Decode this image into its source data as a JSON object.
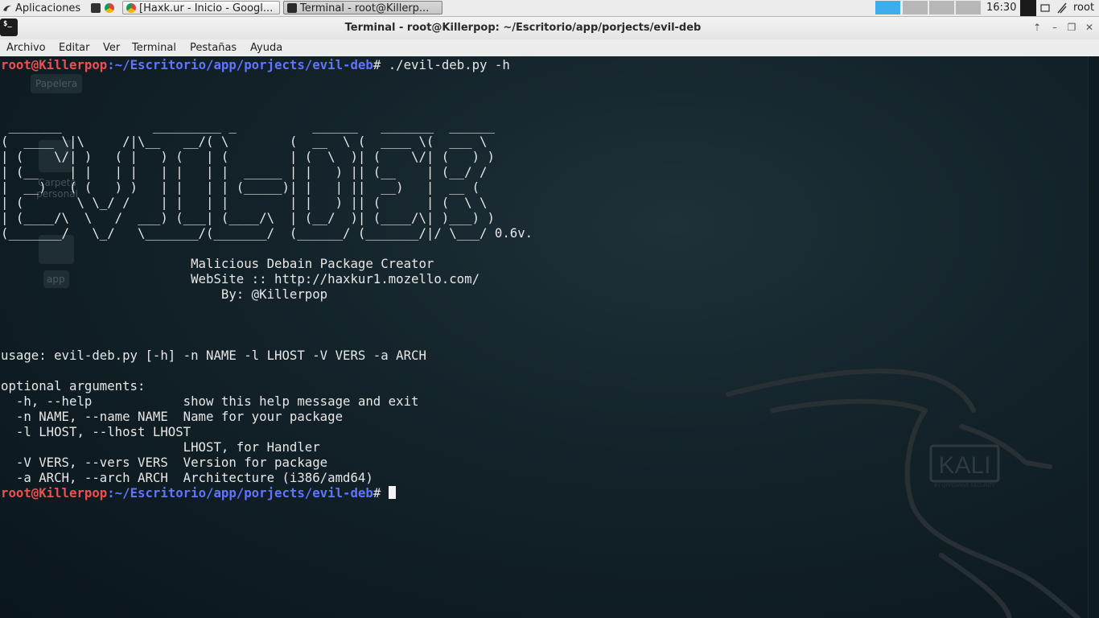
{
  "panel": {
    "apps_label": "Aplicaciones",
    "tasks": [
      {
        "label": "[Haxk.ur - Inicio - Googl..."
      },
      {
        "label": "Terminal - root@Killerp..."
      }
    ],
    "clock": "16:30",
    "user": "root"
  },
  "window": {
    "title": "Terminal - root@Killerpop: ~/Escritorio/app/porjects/evil-deb",
    "menu": [
      "Archivo",
      "Editar",
      "Ver",
      "Terminal",
      "Pestañas",
      "Ayuda"
    ]
  },
  "desktop": {
    "icons": [
      "Papelera",
      "Carpeta personal",
      "app"
    ]
  },
  "terminal": {
    "prompt_user": "root@Killerpop",
    "prompt_path": ":~/Escritorio/app/porjects/evil-deb",
    "prompt_symbol": "# ",
    "command": "./evil-deb.py -h",
    "banner": [
      " _______            _________ _          ______   _______  ______  ",
      "(  ____ \\|\\     /|\\__   __/( \\        (  __  \\ (  ____ \\(  ___ \\ ",
      "| (    \\/| )   ( |   ) (   | (        | (  \\  )| (    \\/| (   ) )",
      "| (__    | |   | |   | |   | |  _____ | |   ) || (__    | (__/ / ",
      "|  __)   ( (   ) )   | |   | | (_____)| |   | ||  __)   |  __ (  ",
      "| (       \\ \\_/ /    | |   | |        | |   ) || (      | (  \\ \\ ",
      "| (____/\\  \\   /  ___) (___| (____/\\  | (__/  )| (____/\\| )___) )",
      "(_______/   \\_/   \\_______/(_______/  (______/ (_______/|/ \\___/ 0.6v."
    ],
    "subtitle": [
      "                         Malicious Debain Package Creator",
      "                         WebSite :: http://haxkur1.mozello.com/",
      "                             By: @Killerpop"
    ],
    "usage": "usage: evil-deb.py [-h] -n NAME -l LHOST -V VERS -a ARCH",
    "optional_header": "optional arguments:",
    "options": [
      "  -h, --help            show this help message and exit",
      "  -n NAME, --name NAME  Name for your package",
      "  -l LHOST, --lhost LHOST",
      "                        LHOST, for Handler",
      "  -V VERS, --vers VERS  Version for package",
      "  -a ARCH, --arch ARCH  Architecture (i386/amd64)"
    ]
  },
  "wallpaper": {
    "logo_text": "KALI",
    "logo_sub": "BY OFFENSIVE SECURITY"
  },
  "colors": {
    "prompt_user": "#ee4f4f",
    "prompt_path": "#5f74ff",
    "terminal_text": "#e7e7e7",
    "workspace_active": "#3daee9"
  }
}
